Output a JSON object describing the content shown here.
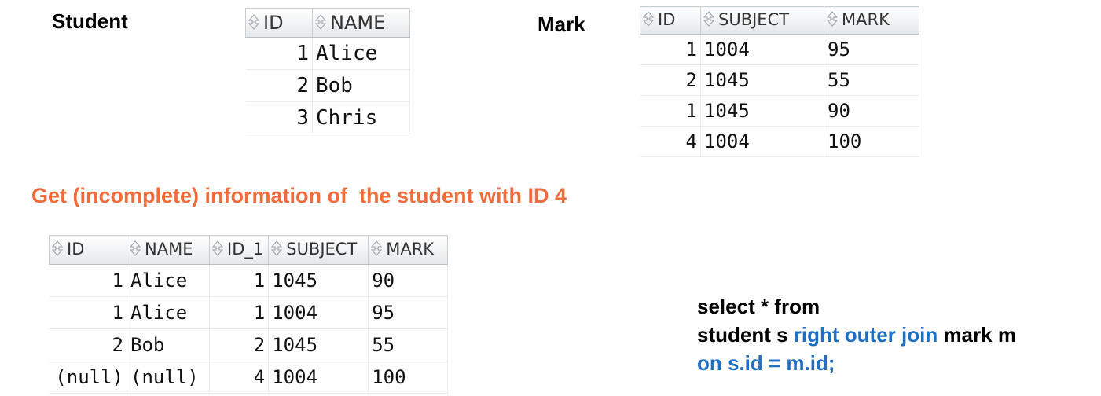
{
  "student": {
    "title": "Student",
    "columns": [
      "ID",
      "NAME"
    ],
    "rows": [
      [
        "1",
        "Alice"
      ],
      [
        "2",
        "Bob"
      ],
      [
        "3",
        "Chris"
      ]
    ]
  },
  "mark": {
    "title": "Mark",
    "columns": [
      "ID",
      "SUBJECT",
      "MARK"
    ],
    "rows": [
      [
        "1",
        "1004",
        "95"
      ],
      [
        "2",
        "1045",
        "55"
      ],
      [
        "1",
        "1045",
        "90"
      ],
      [
        "4",
        "1004",
        "100"
      ]
    ]
  },
  "heading": "Get (incomplete) information of  the student with ID 4",
  "result": {
    "columns": [
      "ID",
      "NAME",
      "ID_1",
      "SUBJECT",
      "MARK"
    ],
    "rows": [
      [
        "1",
        "Alice",
        "1",
        "1045",
        "90"
      ],
      [
        "1",
        "Alice",
        "1",
        "1004",
        "95"
      ],
      [
        "2",
        "Bob",
        "2",
        "1045",
        "55"
      ],
      [
        "(null)",
        "(null)",
        "4",
        "1004",
        "100"
      ]
    ]
  },
  "query": {
    "line1": "select * from",
    "line2_a": "student s ",
    "line2_kw": "right outer join",
    "line2_b": " mark m",
    "line3": "on s.id = m.id;"
  },
  "colors": {
    "heading": "#f26b3a",
    "keyword": "#1f6fc5"
  },
  "icons": {
    "column_header": "sort-arrows-icon"
  }
}
